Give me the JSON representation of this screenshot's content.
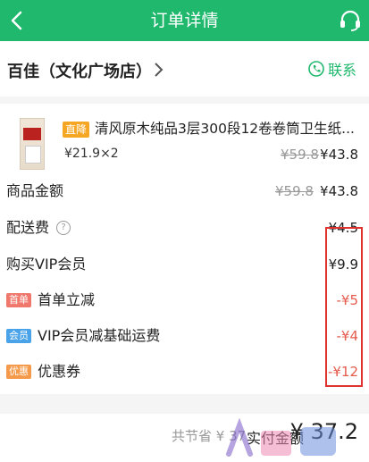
{
  "header": {
    "title": "订单详情",
    "back_icon": "back-chevron-icon",
    "service_icon": "headset-icon",
    "bg_color": "#1fb86c"
  },
  "store": {
    "name": "百佳（文化广场店）",
    "contact_label": "联系",
    "contact_icon": "phone-icon"
  },
  "product": {
    "tag": "直降",
    "name": "清风原木纯品3层300段12卷卷筒卫生纸...",
    "price_qty": "¥21.9×2",
    "original_total": "¥59.8",
    "final_total": "¥43.8"
  },
  "summary": {
    "goods_amount_label": "商品金额",
    "goods_amount_original": "¥59.8",
    "goods_amount": "¥43.8",
    "delivery_label": "配送费",
    "delivery_help_icon": "question-circle-icon",
    "delivery_fee": "¥4.5",
    "vip_label": "购买VIP会员",
    "vip_price": "¥9.9"
  },
  "discounts": [
    {
      "badge": "首单",
      "badge_color": "#f0776b",
      "label": "首单立减",
      "value": "-¥5"
    },
    {
      "badge": "会员",
      "badge_color": "#4aa3e8",
      "label": "VIP会员减基础运费",
      "value": "-¥4"
    },
    {
      "badge": "优惠",
      "badge_color": "#f59a4a",
      "label": "优惠券",
      "value": "-¥12"
    }
  ],
  "footer": {
    "saved_text": "共节省 ¥ 37",
    "pay_label": "实付金额",
    "pay_amount": "¥ 37.2"
  },
  "watermark": "人人都是产品经理"
}
